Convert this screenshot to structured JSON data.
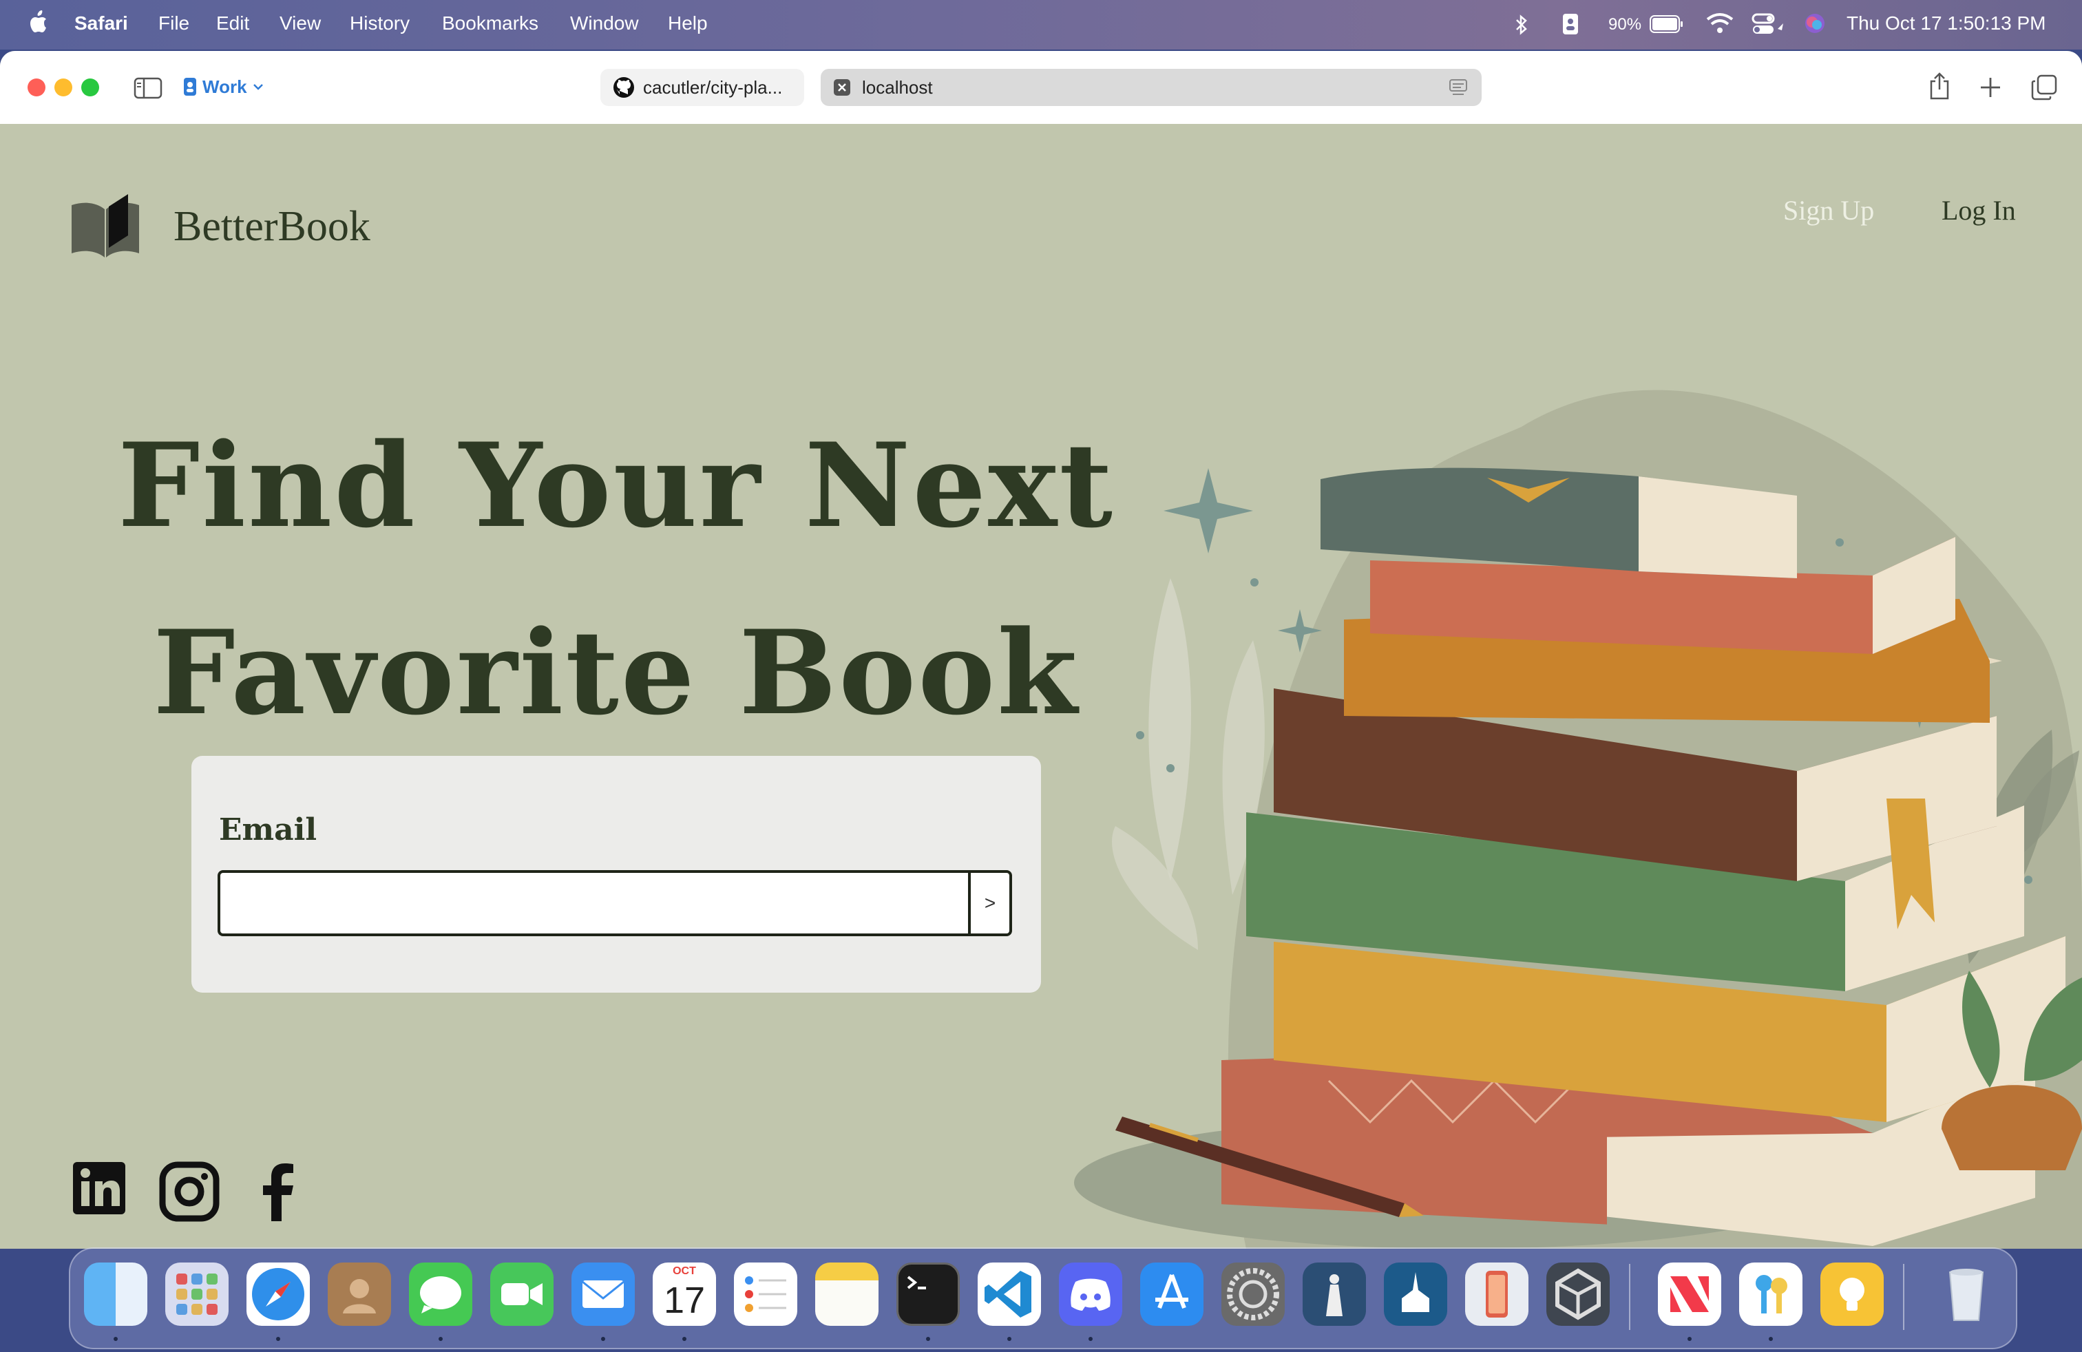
{
  "menubar": {
    "app_name": "Safari",
    "items": [
      "File",
      "Edit",
      "View",
      "History",
      "Bookmarks",
      "Window",
      "Help"
    ],
    "battery": "90%",
    "datetime": "Thu Oct 17  1:50:13 PM"
  },
  "browser": {
    "profile": "Work",
    "tabs": [
      {
        "title": "cacutler/city-pla...",
        "icon": "github-icon"
      },
      {
        "title": "localhost",
        "icon": "close-tab-icon"
      }
    ]
  },
  "site": {
    "brand": "BetterBook",
    "nav": {
      "signup": "Sign Up",
      "login": "Log In"
    },
    "headline_line1": "Find Your Next",
    "headline_line2": "Favorite Book",
    "form": {
      "email_label": "Email",
      "email_value": "",
      "submit_label": ">"
    },
    "social": [
      "linkedin-icon",
      "instagram-icon",
      "facebook-icon"
    ],
    "colors": {
      "background": "#c1c6ad",
      "text_dark": "#2e3a24",
      "card": "#ececea"
    }
  },
  "dock": {
    "calendar_month": "OCT",
    "calendar_day": "17",
    "apps": [
      "finder",
      "launchpad",
      "safari",
      "contacts",
      "messages",
      "facetime",
      "mail",
      "calendar",
      "reminders",
      "notes",
      "terminal",
      "vscode",
      "discord",
      "app-store",
      "system-settings",
      "gospel-library",
      "church-app",
      "iphone-mirroring",
      "unity",
      "news",
      "passwords",
      "tips",
      "trash"
    ]
  }
}
